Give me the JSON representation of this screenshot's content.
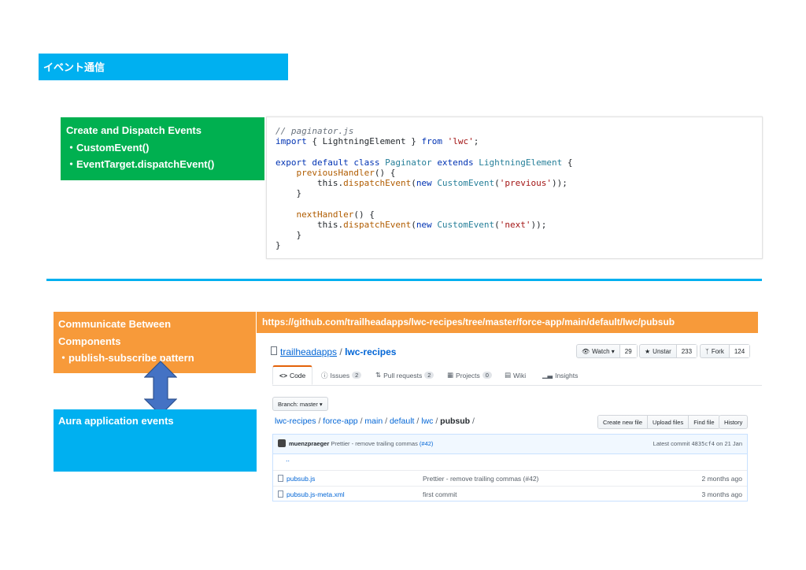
{
  "slide": {
    "title": "イベント通信",
    "divider_color": "#00b0f0"
  },
  "events_box": {
    "title": "Create and Dispatch Events",
    "items": [
      "・CustomEvent()",
      "・EventTarget.dispatchEvent()"
    ],
    "color": "#00b050"
  },
  "code": {
    "lines": [
      [
        {
          "t": "// paginator.js",
          "c": "comment"
        }
      ],
      [
        {
          "t": "import",
          "c": "kw"
        },
        {
          "t": " { LightningElement } ",
          "c": ""
        },
        {
          "t": "from",
          "c": "kw"
        },
        {
          "t": " ",
          "c": ""
        },
        {
          "t": "'lwc'",
          "c": "str"
        },
        {
          "t": ";",
          "c": ""
        }
      ],
      [],
      [
        {
          "t": "export default class",
          "c": "kw"
        },
        {
          "t": " ",
          "c": ""
        },
        {
          "t": "Paginator",
          "c": "cls"
        },
        {
          "t": " ",
          "c": ""
        },
        {
          "t": "extends",
          "c": "kw"
        },
        {
          "t": " ",
          "c": ""
        },
        {
          "t": "LightningElement",
          "c": "cls"
        },
        {
          "t": " {",
          "c": ""
        }
      ],
      [
        {
          "t": "    ",
          "c": ""
        },
        {
          "t": "previousHandler",
          "c": "fn"
        },
        {
          "t": "() {",
          "c": ""
        }
      ],
      [
        {
          "t": "        this.",
          "c": ""
        },
        {
          "t": "dispatchEvent",
          "c": "fn"
        },
        {
          "t": "(",
          "c": ""
        },
        {
          "t": "new",
          "c": "kw"
        },
        {
          "t": " ",
          "c": ""
        },
        {
          "t": "CustomEvent",
          "c": "cls"
        },
        {
          "t": "(",
          "c": ""
        },
        {
          "t": "'previous'",
          "c": "str"
        },
        {
          "t": "));",
          "c": ""
        }
      ],
      [
        {
          "t": "    }",
          "c": ""
        }
      ],
      [],
      [
        {
          "t": "    ",
          "c": ""
        },
        {
          "t": "nextHandler",
          "c": "fn"
        },
        {
          "t": "() {",
          "c": ""
        }
      ],
      [
        {
          "t": "        this.",
          "c": ""
        },
        {
          "t": "dispatchEvent",
          "c": "fn"
        },
        {
          "t": "(",
          "c": ""
        },
        {
          "t": "new",
          "c": "kw"
        },
        {
          "t": " ",
          "c": ""
        },
        {
          "t": "CustomEvent",
          "c": "cls"
        },
        {
          "t": "(",
          "c": ""
        },
        {
          "t": "'next'",
          "c": "str"
        },
        {
          "t": "));",
          "c": ""
        }
      ],
      [
        {
          "t": "    }",
          "c": ""
        }
      ],
      [
        {
          "t": "}",
          "c": ""
        }
      ]
    ]
  },
  "pubsub_box": {
    "lines": [
      "Communicate Between",
      "Components",
      "・publish-subscribe pattern"
    ],
    "color": "#f79a3a"
  },
  "aura_box": {
    "title": "Aura application events",
    "color": "#00b0f0"
  },
  "url": "https://github.com/trailheadapps/lwc-recipes/tree/master/force-app/main/default/lwc/pubsub",
  "github": {
    "owner": "trailheadapps",
    "separator": "/",
    "repo": "lwc-recipes",
    "watch": {
      "label": "Watch ▾",
      "count": "29",
      "icon": "eye-icon"
    },
    "unstar": {
      "label": "Unstar",
      "count": "233",
      "icon": "star-icon"
    },
    "fork": {
      "label": "Fork",
      "count": "124",
      "icon": "fork-icon"
    },
    "tabs": [
      {
        "label": "Code",
        "icon": "code-icon",
        "badge": ""
      },
      {
        "label": "Issues",
        "icon": "issue-icon",
        "badge": "2"
      },
      {
        "label": "Pull requests",
        "icon": "pull-request-icon",
        "badge": "2"
      },
      {
        "label": "Projects",
        "icon": "project-icon",
        "badge": "0"
      },
      {
        "label": "Wiki",
        "icon": "wiki-icon",
        "badge": ""
      },
      {
        "label": "Insights",
        "icon": "graph-icon",
        "badge": ""
      }
    ],
    "branch": "Branch: master ▾",
    "path": [
      "lwc-recipes",
      "force-app",
      "main",
      "default",
      "lwc"
    ],
    "path_final": "pubsub",
    "path_sep": "/",
    "file_actions": [
      "Create new file",
      "Upload files",
      "Find file"
    ],
    "history": "History",
    "commit": {
      "author": "muenzpraeger",
      "message": "Prettier - remove trailing commas",
      "pr": "(#42)",
      "latest_label": "Latest commit",
      "sha": "4835cf4",
      "date": "on 21 Jan"
    },
    "up_dir": "..",
    "files": [
      {
        "name": "pubsub.js",
        "message": "Prettier - remove trailing commas (#42)",
        "age": "2 months ago"
      },
      {
        "name": "pubsub.js-meta.xml",
        "message": "first commit",
        "age": "3 months ago"
      }
    ]
  }
}
